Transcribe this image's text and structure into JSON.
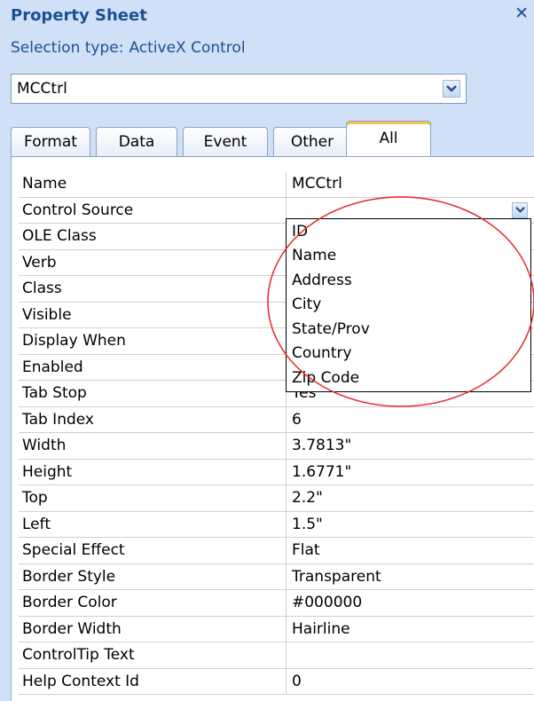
{
  "panel": {
    "title": "Property Sheet",
    "close_glyph": "✕",
    "selection_type_label": "Selection type:",
    "selection_type_value": "ActiveX Control"
  },
  "combo": {
    "value": "MCCtrl",
    "button_icon": "chevron-down-icon"
  },
  "tabs": [
    {
      "label": "Format",
      "active": false
    },
    {
      "label": "Data",
      "active": false
    },
    {
      "label": "Event",
      "active": false
    },
    {
      "label": "Other",
      "active": false
    },
    {
      "label": "All",
      "active": true
    }
  ],
  "properties": [
    {
      "name": "Name",
      "value": "MCCtrl"
    },
    {
      "name": "Control Source",
      "value": ""
    },
    {
      "name": "OLE Class",
      "value": ""
    },
    {
      "name": "Verb",
      "value": ""
    },
    {
      "name": "Class",
      "value": ""
    },
    {
      "name": "Visible",
      "value": ""
    },
    {
      "name": "Display When",
      "value": ""
    },
    {
      "name": "Enabled",
      "value": ""
    },
    {
      "name": "Tab Stop",
      "value": "Yes"
    },
    {
      "name": "Tab Index",
      "value": "6"
    },
    {
      "name": "Width",
      "value": "3.7813\""
    },
    {
      "name": "Height",
      "value": "1.6771\""
    },
    {
      "name": "Top",
      "value": "2.2\""
    },
    {
      "name": "Left",
      "value": "1.5\""
    },
    {
      "name": "Special Effect",
      "value": "Flat"
    },
    {
      "name": "Border Style",
      "value": "Transparent"
    },
    {
      "name": "Border Color",
      "value": "#000000"
    },
    {
      "name": "Border Width",
      "value": "Hairline"
    },
    {
      "name": "ControlTip Text",
      "value": ""
    },
    {
      "name": "Help Context Id",
      "value": "0"
    }
  ],
  "dropdown": {
    "options": [
      "ID",
      "Name",
      "Address",
      "City",
      "State/Prov",
      "Country",
      "Zip Code"
    ]
  },
  "colors": {
    "title": "#1f4f93",
    "background": "#cfe0f7",
    "annotation": "#e8252a",
    "tab_highlight": "#f5c34f"
  }
}
